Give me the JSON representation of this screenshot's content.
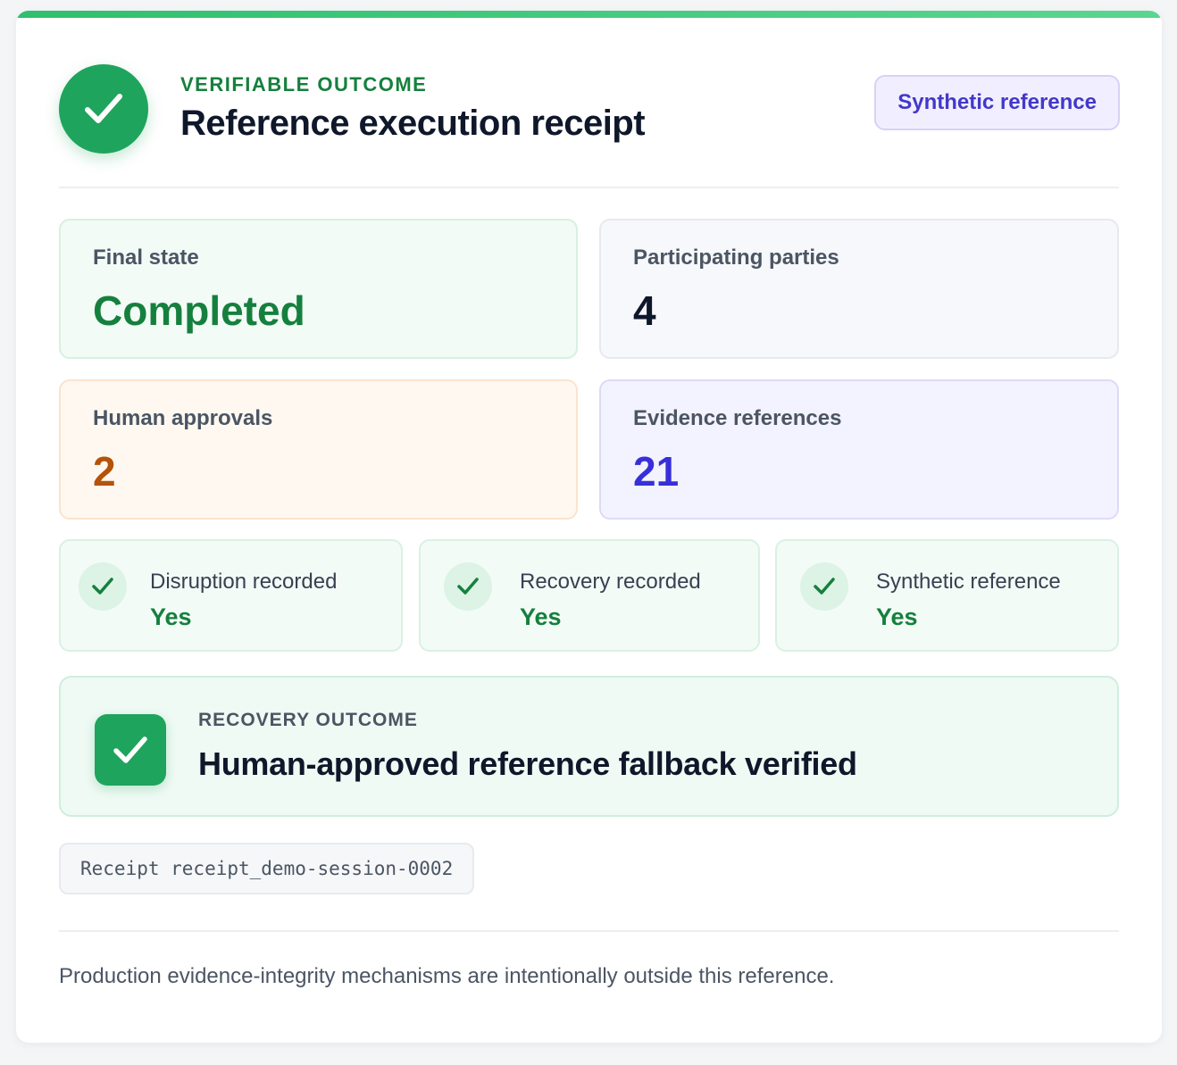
{
  "header": {
    "eyebrow": "VERIFIABLE OUTCOME",
    "title": "Reference execution receipt",
    "badge": "Synthetic reference"
  },
  "stats": [
    {
      "label": "Final state",
      "value": "Completed",
      "color": "#15803d"
    },
    {
      "label": "Participating parties",
      "value": "4",
      "color": "#0f172a"
    },
    {
      "label": "Human approvals",
      "value": "2",
      "color": "#b45309"
    },
    {
      "label": "Evidence references",
      "value": "21",
      "color": "#3730d8"
    }
  ],
  "flags": [
    {
      "label": "Disruption recorded",
      "value": "Yes"
    },
    {
      "label": "Recovery recorded",
      "value": "Yes"
    },
    {
      "label": "Synthetic reference",
      "value": "Yes"
    }
  ],
  "outcome": {
    "eyebrow": "RECOVERY OUTCOME",
    "title": "Human-approved reference fallback verified"
  },
  "receipt": {
    "text": "Receipt receipt_demo-session-0002"
  },
  "footnote": "Production evidence-integrity mechanisms are intentionally outside this reference.",
  "colors": {
    "accent_green": "#1fa45d",
    "badge_purple": "#4338ca"
  },
  "icons": {
    "status": "check-icon"
  }
}
